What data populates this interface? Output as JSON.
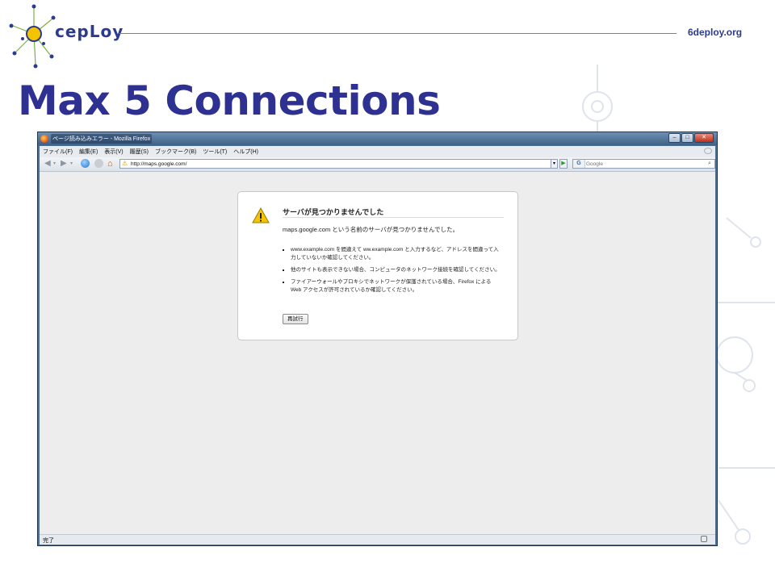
{
  "slide": {
    "logo_text": "cepLoy",
    "site_url": "6deploy.org",
    "title": "Max 5 Connections"
  },
  "browser": {
    "window_title": "ページ読み込みエラー - Mozilla Firefox",
    "menu": [
      "ファイル(F)",
      "編集(E)",
      "表示(V)",
      "履歴(S)",
      "ブックマーク(B)",
      "ツール(T)",
      "ヘルプ(H)"
    ],
    "url": "http://maps.google.com/",
    "search_placeholder": "Google",
    "status": "完了"
  },
  "error": {
    "title": "サーバが見つかりませんでした",
    "description": "maps.google.com という名前のサーバが見つかりませんでした。",
    "bullets": [
      "www.example.com を間違えて ww.example.com と入力するなど、アドレスを間違って入力していないか確認してください。",
      "他のサイトも表示できない場合、コンピュータのネットワーク接続を確認してください。",
      "ファイアーウォールやプロキシでネットワークが保護されている場合、Firefox による Web アクセスが許可されているか確認してください。"
    ],
    "retry_label": "再試行"
  },
  "icons": {
    "back": "back-arrow-icon",
    "forward": "forward-arrow-icon",
    "reload": "reload-icon",
    "stop": "stop-icon",
    "home": "home-icon",
    "warning": "warning-triangle-icon",
    "go": "go-arrow-icon",
    "search": "magnifier-icon"
  },
  "colors": {
    "title": "#2e3192",
    "brand": "#2d3b8e",
    "titlebar": "#4d6f93",
    "warning": "#f5c400"
  }
}
